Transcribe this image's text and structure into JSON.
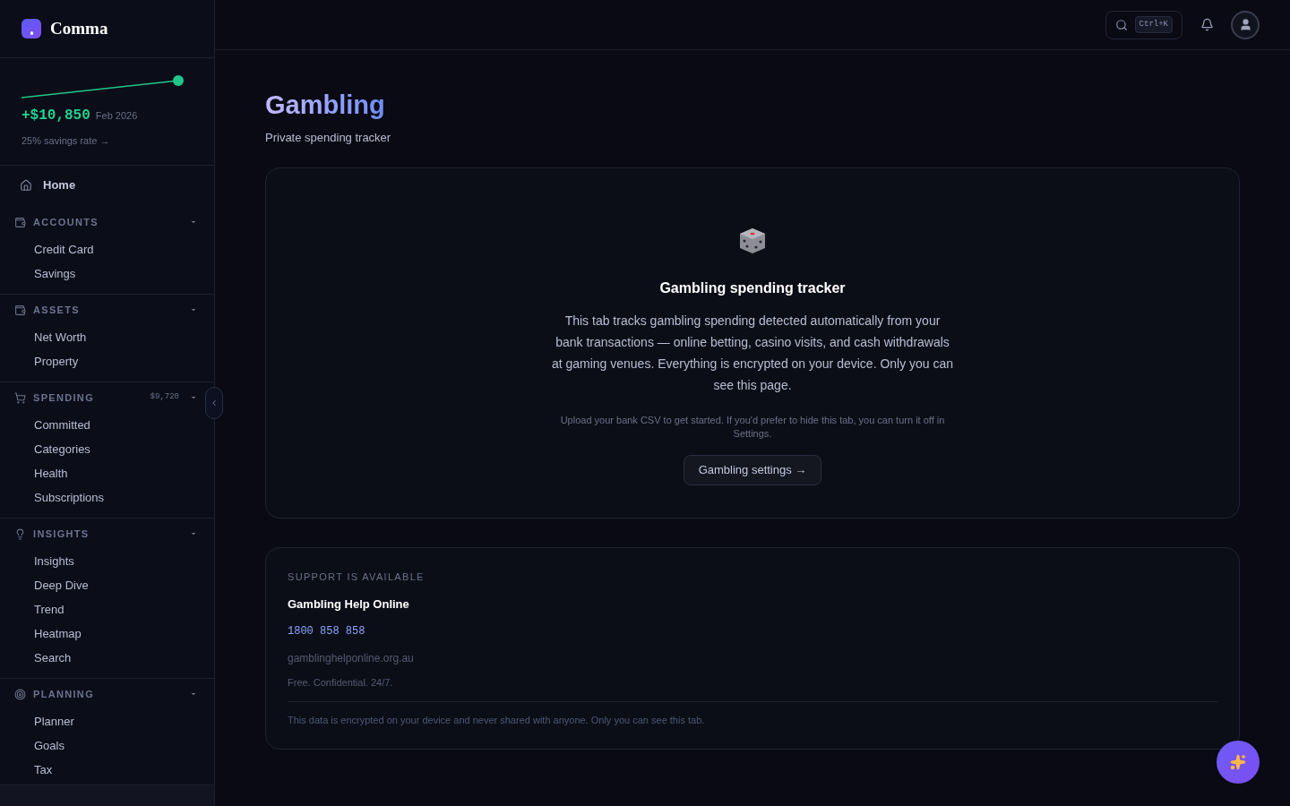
{
  "brand": {
    "name": "Comma"
  },
  "savings": {
    "amount": "+$10,850",
    "period": "Feb 2026",
    "rate": "25% savings rate →"
  },
  "sidebar": {
    "home": "Home",
    "sections": [
      {
        "title": "ACCOUNTS",
        "expanded": true,
        "items": [
          "Credit Card",
          "Savings"
        ]
      },
      {
        "title": "ASSETS",
        "expanded": true,
        "items": [
          "Net Worth",
          "Property"
        ]
      },
      {
        "title": "SPENDING",
        "total": "$9,720",
        "expanded": true,
        "items": [
          "Committed",
          "Categories",
          "Health",
          "Subscriptions"
        ]
      },
      {
        "title": "INSIGHTS",
        "expanded": true,
        "items": [
          "Insights",
          "Deep Dive",
          "Trend",
          "Heatmap",
          "Search"
        ]
      },
      {
        "title": "PLANNING",
        "expanded": true,
        "items": [
          "Planner",
          "Goals",
          "Tax"
        ]
      }
    ]
  },
  "header": {
    "shortcut": "Ctrl+K"
  },
  "page": {
    "title": "Gambling",
    "subtitle": "Private spending tracker"
  },
  "tracker": {
    "title": "Gambling spending tracker",
    "body": "This tab tracks gambling spending detected automatically from your bank transactions — online betting, casino visits, and cash withdrawals at gaming venues. Everything is encrypted on your device. Only you can see this page.",
    "hint": "Upload your bank CSV to get started. If you'd prefer to hide this tab, you can turn it off in Settings.",
    "button": "Gambling settings →"
  },
  "support": {
    "label": "SUPPORT IS AVAILABLE",
    "name": "Gambling Help Online",
    "phone": "1800 858 858",
    "website": "gamblinghelponline.org.au",
    "note": "Free. Confidential. 24/7.",
    "privacy": "This data is encrypted on your device and never shared with anyone. Only you can see this tab."
  }
}
